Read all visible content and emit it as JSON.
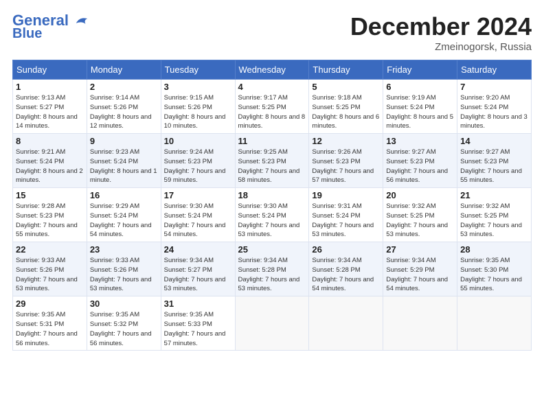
{
  "header": {
    "logo_line1": "General",
    "logo_line2": "Blue",
    "month_title": "December 2024",
    "location": "Zmeinogorsk, Russia"
  },
  "weekdays": [
    "Sunday",
    "Monday",
    "Tuesday",
    "Wednesday",
    "Thursday",
    "Friday",
    "Saturday"
  ],
  "weeks": [
    [
      {
        "day": "1",
        "sunrise": "9:13 AM",
        "sunset": "5:27 PM",
        "daylight": "8 hours and 14 minutes."
      },
      {
        "day": "2",
        "sunrise": "9:14 AM",
        "sunset": "5:26 PM",
        "daylight": "8 hours and 12 minutes."
      },
      {
        "day": "3",
        "sunrise": "9:15 AM",
        "sunset": "5:26 PM",
        "daylight": "8 hours and 10 minutes."
      },
      {
        "day": "4",
        "sunrise": "9:17 AM",
        "sunset": "5:25 PM",
        "daylight": "8 hours and 8 minutes."
      },
      {
        "day": "5",
        "sunrise": "9:18 AM",
        "sunset": "5:25 PM",
        "daylight": "8 hours and 6 minutes."
      },
      {
        "day": "6",
        "sunrise": "9:19 AM",
        "sunset": "5:24 PM",
        "daylight": "8 hours and 5 minutes."
      },
      {
        "day": "7",
        "sunrise": "9:20 AM",
        "sunset": "5:24 PM",
        "daylight": "8 hours and 3 minutes."
      }
    ],
    [
      {
        "day": "8",
        "sunrise": "9:21 AM",
        "sunset": "5:24 PM",
        "daylight": "8 hours and 2 minutes."
      },
      {
        "day": "9",
        "sunrise": "9:23 AM",
        "sunset": "5:24 PM",
        "daylight": "8 hours and 1 minute."
      },
      {
        "day": "10",
        "sunrise": "9:24 AM",
        "sunset": "5:23 PM",
        "daylight": "7 hours and 59 minutes."
      },
      {
        "day": "11",
        "sunrise": "9:25 AM",
        "sunset": "5:23 PM",
        "daylight": "7 hours and 58 minutes."
      },
      {
        "day": "12",
        "sunrise": "9:26 AM",
        "sunset": "5:23 PM",
        "daylight": "7 hours and 57 minutes."
      },
      {
        "day": "13",
        "sunrise": "9:27 AM",
        "sunset": "5:23 PM",
        "daylight": "7 hours and 56 minutes."
      },
      {
        "day": "14",
        "sunrise": "9:27 AM",
        "sunset": "5:23 PM",
        "daylight": "7 hours and 55 minutes."
      }
    ],
    [
      {
        "day": "15",
        "sunrise": "9:28 AM",
        "sunset": "5:23 PM",
        "daylight": "7 hours and 55 minutes."
      },
      {
        "day": "16",
        "sunrise": "9:29 AM",
        "sunset": "5:24 PM",
        "daylight": "7 hours and 54 minutes."
      },
      {
        "day": "17",
        "sunrise": "9:30 AM",
        "sunset": "5:24 PM",
        "daylight": "7 hours and 54 minutes."
      },
      {
        "day": "18",
        "sunrise": "9:30 AM",
        "sunset": "5:24 PM",
        "daylight": "7 hours and 53 minutes."
      },
      {
        "day": "19",
        "sunrise": "9:31 AM",
        "sunset": "5:24 PM",
        "daylight": "7 hours and 53 minutes."
      },
      {
        "day": "20",
        "sunrise": "9:32 AM",
        "sunset": "5:25 PM",
        "daylight": "7 hours and 53 minutes."
      },
      {
        "day": "21",
        "sunrise": "9:32 AM",
        "sunset": "5:25 PM",
        "daylight": "7 hours and 53 minutes."
      }
    ],
    [
      {
        "day": "22",
        "sunrise": "9:33 AM",
        "sunset": "5:26 PM",
        "daylight": "7 hours and 53 minutes."
      },
      {
        "day": "23",
        "sunrise": "9:33 AM",
        "sunset": "5:26 PM",
        "daylight": "7 hours and 53 minutes."
      },
      {
        "day": "24",
        "sunrise": "9:34 AM",
        "sunset": "5:27 PM",
        "daylight": "7 hours and 53 minutes."
      },
      {
        "day": "25",
        "sunrise": "9:34 AM",
        "sunset": "5:28 PM",
        "daylight": "7 hours and 53 minutes."
      },
      {
        "day": "26",
        "sunrise": "9:34 AM",
        "sunset": "5:28 PM",
        "daylight": "7 hours and 54 minutes."
      },
      {
        "day": "27",
        "sunrise": "9:34 AM",
        "sunset": "5:29 PM",
        "daylight": "7 hours and 54 minutes."
      },
      {
        "day": "28",
        "sunrise": "9:35 AM",
        "sunset": "5:30 PM",
        "daylight": "7 hours and 55 minutes."
      }
    ],
    [
      {
        "day": "29",
        "sunrise": "9:35 AM",
        "sunset": "5:31 PM",
        "daylight": "7 hours and 56 minutes."
      },
      {
        "day": "30",
        "sunrise": "9:35 AM",
        "sunset": "5:32 PM",
        "daylight": "7 hours and 56 minutes."
      },
      {
        "day": "31",
        "sunrise": "9:35 AM",
        "sunset": "5:33 PM",
        "daylight": "7 hours and 57 minutes."
      },
      null,
      null,
      null,
      null
    ]
  ]
}
